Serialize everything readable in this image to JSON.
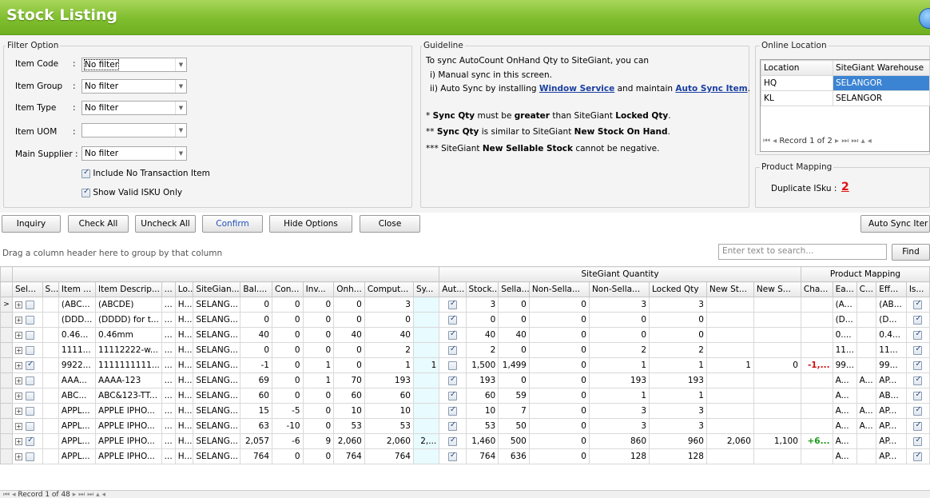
{
  "title": "Stock Listing",
  "colors": {
    "title_bar": "#7fbd2e",
    "selected_row": "#3b83d3",
    "accent_link": "#1a3fa0",
    "negative": "#d01010",
    "positive": "#1a9a1a"
  },
  "filter": {
    "legend": "Filter Option",
    "item_code_label": "Item Code",
    "item_code_value": "No filter",
    "item_group_label": "Item Group",
    "item_group_value": "No filter",
    "item_type_label": "Item Type",
    "item_type_value": "No filter",
    "item_uom_label": "Item UOM",
    "item_uom_value": "",
    "main_supplier_label": "Main Supplier :",
    "main_supplier_value": "No filter",
    "colon": ":",
    "include_no_trans": "Include No Transaction Item",
    "show_valid_isku": "Show Valid ISKU Only"
  },
  "guideline": {
    "legend": "Guideline",
    "line1": "To sync AutoCount OnHand Qty to SiteGiant, you can",
    "line2": "i) Manual sync in this screen.",
    "line3_pre": "ii) Auto Sync by installing ",
    "line3_link1": "Window Service",
    "line3_mid": " and maintain ",
    "line3_link2": "Auto Sync Item",
    "line3_post": ".",
    "note1_pre": "* ",
    "note1_b1": "Sync Qty",
    "note1_mid": " must be ",
    "note1_b2": "greater",
    "note1_mid2": " than SiteGiant ",
    "note1_b3": "Locked Qty",
    "note1_post": ".",
    "note2_pre": "** ",
    "note2_b1": "Sync Qty",
    "note2_mid": " is similar to SiteGiant ",
    "note2_b2": "New Stock On Hand",
    "note2_post": ".",
    "note3_pre": "*** SiteGiant ",
    "note3_b1": "New Sellable Stock",
    "note3_post": " cannot be negative."
  },
  "online_location": {
    "legend": "Online Location",
    "col_location": "Location",
    "col_warehouse": "SiteGiant Warehouse",
    "rows": [
      {
        "location": "HQ",
        "warehouse": "SELANGOR"
      },
      {
        "location": "KL",
        "warehouse": "SELANGOR"
      }
    ],
    "nav_record": "Record 1 of 2"
  },
  "product_mapping": {
    "legend": "Product Mapping",
    "duplicate_label": "Duplicate ISku  :",
    "duplicate_value": "2"
  },
  "buttons": {
    "inquiry": "Inquiry",
    "check_all": "Check All",
    "uncheck_all": "Uncheck All",
    "confirm": "Confirm",
    "hide_options": "Hide Options",
    "close": "Close",
    "auto_sync": "Auto Sync Iter",
    "find": "Find"
  },
  "grid": {
    "group_hint": "Drag a column header here to group by that column",
    "search_placeholder": "Enter text to search...",
    "band_sitegiant": "SiteGiant Quantity",
    "band_mapping": "Product Mapping",
    "columns": [
      "Sel...",
      "S...",
      "Item ...",
      "Item Descrip...",
      "...",
      "Lo...",
      "SiteGian...",
      "Bal....",
      "Con...",
      "Inv...",
      "Onh...",
      "Comput...",
      "Sy...",
      "Aut...",
      "Stock...",
      "Sella...",
      "Non-Sella...",
      "Non-Sella...",
      "Locked Qty",
      "New St...",
      "New S...",
      "Cha...",
      "Ea...",
      "C...",
      "Eff...",
      "Is..."
    ],
    "rows": [
      {
        "sel": false,
        "code": "(ABC...",
        "desc": "(ABCDE)",
        "dots": "...",
        "lo": "H...",
        "sg": "SELANG...",
        "bal": "0",
        "con": "0",
        "inv": "0",
        "onh": "0",
        "comp": "3",
        "sy": "",
        "aut": true,
        "stock": "3",
        "sell": "0",
        "ns1": "0",
        "ns2": "3",
        "locked": "3",
        "newst": "",
        "news": "",
        "cha": "",
        "ea": "(A...",
        "c": "",
        "eff": "(AB...",
        "is": true
      },
      {
        "sel": false,
        "code": "(DDD...",
        "desc": "(DDDD) for t...",
        "dots": "...",
        "lo": "H...",
        "sg": "SELANG...",
        "bal": "0",
        "con": "0",
        "inv": "0",
        "onh": "0",
        "comp": "0",
        "sy": "",
        "aut": true,
        "stock": "0",
        "sell": "0",
        "ns1": "0",
        "ns2": "0",
        "locked": "0",
        "newst": "",
        "news": "",
        "cha": "",
        "ea": "(D...",
        "c": "",
        "eff": "(D...",
        "is": true
      },
      {
        "sel": false,
        "code": "0.46...",
        "desc": "0.46mm",
        "dots": "...",
        "lo": "H...",
        "sg": "SELANG...",
        "bal": "40",
        "con": "0",
        "inv": "0",
        "onh": "40",
        "comp": "40",
        "sy": "",
        "aut": true,
        "stock": "40",
        "sell": "40",
        "ns1": "0",
        "ns2": "0",
        "locked": "0",
        "newst": "",
        "news": "",
        "cha": "",
        "ea": "0....",
        "c": "",
        "eff": "0.4...",
        "is": true
      },
      {
        "sel": false,
        "code": "1111...",
        "desc": "11112222-w...",
        "dots": "...",
        "lo": "H...",
        "sg": "SELANG...",
        "bal": "0",
        "con": "0",
        "inv": "0",
        "onh": "0",
        "comp": "2",
        "sy": "",
        "aut": true,
        "stock": "2",
        "sell": "0",
        "ns1": "0",
        "ns2": "2",
        "locked": "2",
        "newst": "",
        "news": "",
        "cha": "",
        "ea": "11...",
        "c": "",
        "eff": "11...",
        "is": true
      },
      {
        "sel": true,
        "code": "9922...",
        "desc": "1111111111...",
        "dots": "...",
        "lo": "H...",
        "sg": "SELANG...",
        "bal": "-1",
        "con": "0",
        "inv": "1",
        "onh": "0",
        "comp": "1",
        "sy": "1",
        "aut": false,
        "stock": "1,500",
        "sell": "1,499",
        "ns1": "0",
        "ns2": "1",
        "locked": "1",
        "newst": "1",
        "news": "0",
        "cha": "-1,...",
        "chaType": "neg",
        "ea": "99...",
        "c": "",
        "eff": "99...",
        "is": true
      },
      {
        "sel": false,
        "code": "AAA...",
        "desc": "AAAA-123",
        "dots": "...",
        "lo": "H...",
        "sg": "SELANG...",
        "bal": "69",
        "con": "0",
        "inv": "1",
        "onh": "70",
        "comp": "193",
        "sy": "",
        "aut": true,
        "stock": "193",
        "sell": "0",
        "ns1": "0",
        "ns2": "193",
        "locked": "193",
        "newst": "",
        "news": "",
        "cha": "",
        "ea": "A...",
        "c": "A...",
        "eff": "AP...",
        "is": true
      },
      {
        "sel": false,
        "code": "ABC...",
        "desc": "ABC&123-TT...",
        "dots": "...",
        "lo": "H...",
        "sg": "SELANG...",
        "bal": "60",
        "con": "0",
        "inv": "0",
        "onh": "60",
        "comp": "60",
        "sy": "",
        "aut": true,
        "stock": "60",
        "sell": "59",
        "ns1": "0",
        "ns2": "1",
        "locked": "1",
        "newst": "",
        "news": "",
        "cha": "",
        "ea": "A...",
        "c": "",
        "eff": "AB...",
        "is": true
      },
      {
        "sel": false,
        "code": "APPL...",
        "desc": "APPLE IPHO...",
        "dots": "...",
        "lo": "H...",
        "sg": "SELANG...",
        "bal": "15",
        "con": "-5",
        "inv": "0",
        "onh": "10",
        "comp": "10",
        "sy": "",
        "aut": true,
        "stock": "10",
        "sell": "7",
        "ns1": "0",
        "ns2": "3",
        "locked": "3",
        "newst": "",
        "news": "",
        "cha": "",
        "ea": "A...",
        "c": "A...",
        "eff": "AP...",
        "is": true
      },
      {
        "sel": false,
        "code": "APPL...",
        "desc": "APPLE IPHO...",
        "dots": "...",
        "lo": "H...",
        "sg": "SELANG...",
        "bal": "63",
        "con": "-10",
        "inv": "0",
        "onh": "53",
        "comp": "53",
        "sy": "",
        "aut": true,
        "stock": "53",
        "sell": "50",
        "ns1": "0",
        "ns2": "3",
        "locked": "3",
        "newst": "",
        "news": "",
        "cha": "",
        "ea": "A...",
        "c": "A...",
        "eff": "AP...",
        "is": true
      },
      {
        "sel": true,
        "code": "APPL...",
        "desc": "APPLE IPHO...",
        "dots": "...",
        "lo": "H...",
        "sg": "SELANG...",
        "bal": "2,057",
        "con": "-6",
        "inv": "9",
        "onh": "2,060",
        "comp": "2,060",
        "sy": "2,...",
        "aut": true,
        "stock": "1,460",
        "sell": "500",
        "ns1": "0",
        "ns2": "860",
        "locked": "960",
        "newst": "2,060",
        "news": "1,100",
        "cha": "+6...",
        "chaType": "pos",
        "ea": "A...",
        "c": "",
        "eff": "AP...",
        "is": true
      },
      {
        "sel": false,
        "code": "APPL...",
        "desc": "APPLE IPHO...",
        "dots": "...",
        "lo": "H...",
        "sg": "SELANG...",
        "bal": "764",
        "con": "0",
        "inv": "0",
        "onh": "764",
        "comp": "764",
        "sy": "",
        "aut": true,
        "stock": "764",
        "sell": "636",
        "ns1": "0",
        "ns2": "128",
        "locked": "128",
        "newst": "",
        "news": "",
        "cha": "",
        "ea": "A...",
        "c": "",
        "eff": "AP...",
        "is": true
      }
    ],
    "nav_record": "Record 1 of 48"
  }
}
